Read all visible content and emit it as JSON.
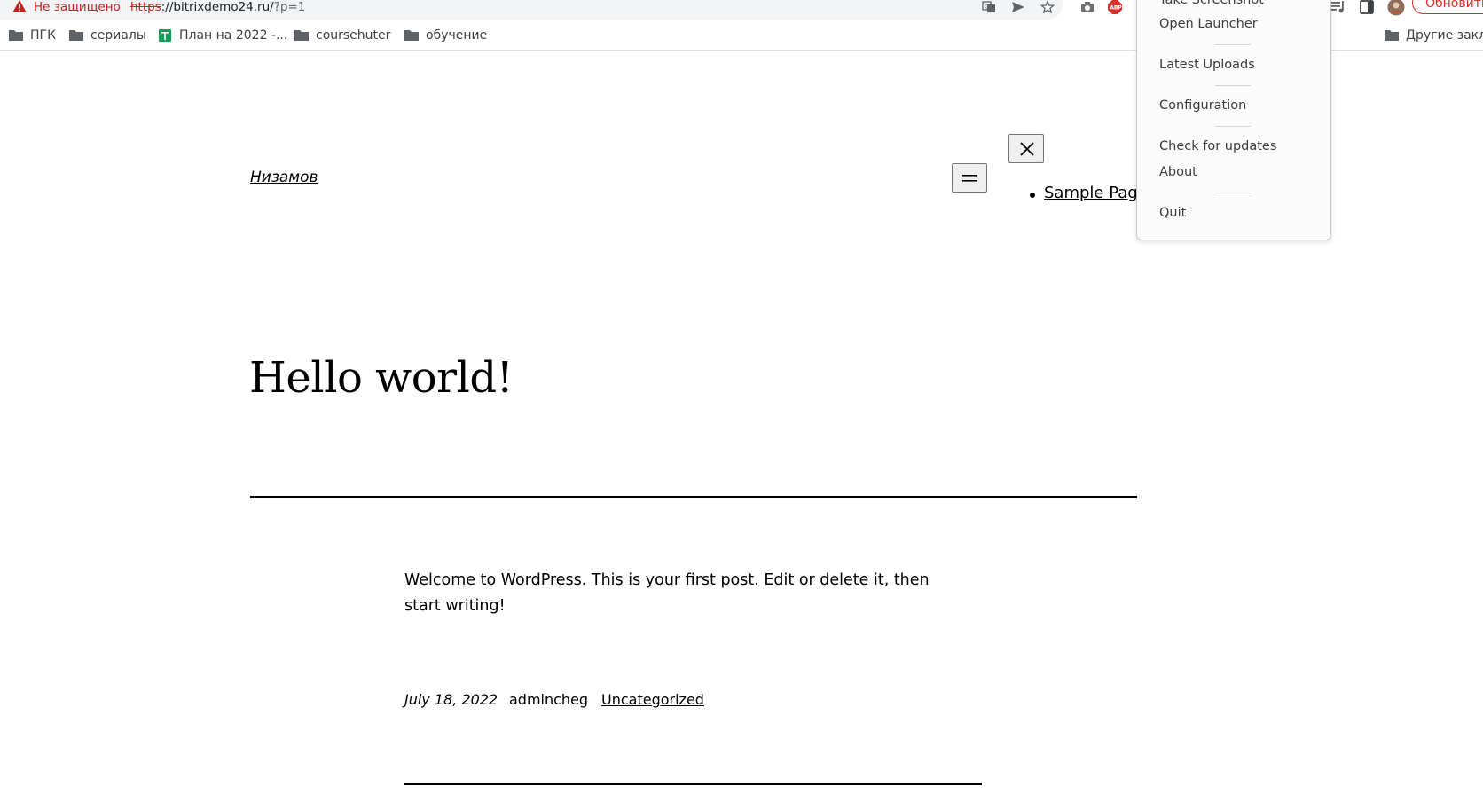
{
  "browser": {
    "security_label": "Не защищено",
    "url_scheme": "https",
    "url_host": "://bitrixdemo24.ru/",
    "url_path": "?p=1",
    "update_button": "Обновить",
    "warning_color": "#c5221f",
    "icons": [
      "translate-icon",
      "send-icon",
      "star-icon",
      "camera-icon",
      "adblock-icon",
      "extension-icon",
      "puzzle-icon",
      "media-icon",
      "sidepanel-icon",
      "avatar"
    ]
  },
  "bookmarks": {
    "items": [
      {
        "label": "ПГК",
        "icon": "folder-icon"
      },
      {
        "label": "сериалы",
        "icon": "folder-icon"
      },
      {
        "label": "План на 2022 -...",
        "icon": "sheets-icon"
      },
      {
        "label": "coursehuter",
        "icon": "folder-icon"
      },
      {
        "label": "обучение",
        "icon": "folder-icon"
      }
    ],
    "other": "Другие закла"
  },
  "site": {
    "title": "Низамов",
    "nav_items": [
      "Sample Page"
    ]
  },
  "post": {
    "title": "Hello world!",
    "excerpt": "Welcome to WordPress. This is your first post. Edit or delete it, then start writing!",
    "date": "July 18, 2022",
    "author": "admincheg",
    "category": "Uncategorized"
  },
  "context_menu": {
    "items": [
      "Take Screenshot",
      "Open Launcher",
      "Latest Uploads",
      "Configuration",
      "Check for updates",
      "About",
      "Quit"
    ]
  }
}
